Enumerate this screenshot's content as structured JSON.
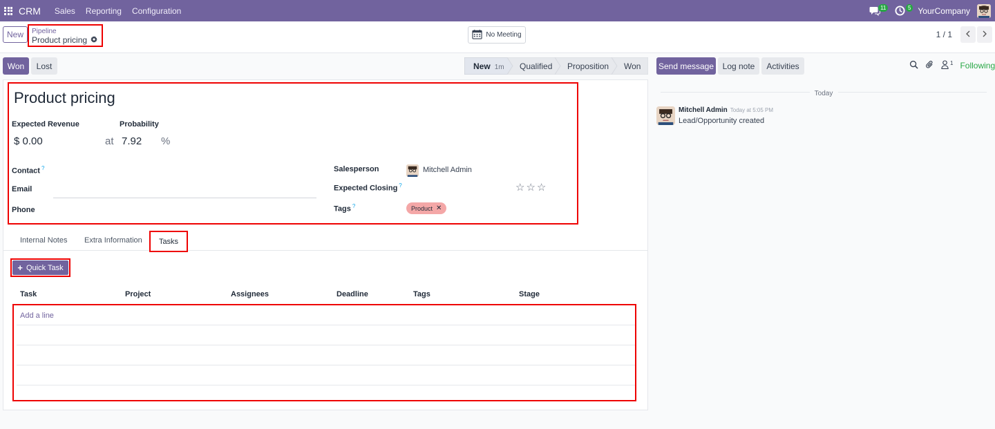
{
  "topbar": {
    "app_name": "CRM",
    "menu": [
      "Sales",
      "Reporting",
      "Configuration"
    ],
    "messages_count": "11",
    "activities_count": "5",
    "company": "YourCompany"
  },
  "control_panel": {
    "new_label": "New",
    "breadcrumb_parent": "Pipeline",
    "breadcrumb_current": "Product pricing",
    "meeting_label": "No Meeting",
    "pager": "1 / 1"
  },
  "statusbar": {
    "won_label": "Won",
    "lost_label": "Lost",
    "stages": [
      {
        "label": "New",
        "duration": "1m",
        "active": true
      },
      {
        "label": "Qualified"
      },
      {
        "label": "Proposition"
      },
      {
        "label": "Won"
      }
    ]
  },
  "chatter": {
    "send_label": "Send message",
    "log_label": "Log note",
    "activities_label": "Activities",
    "followers_count": "1",
    "following_label": "Following",
    "date_separator": "Today",
    "message": {
      "author": "Mitchell Admin",
      "time": "Today at 5:05 PM",
      "body": "Lead/Opportunity created"
    }
  },
  "form": {
    "title": "Product pricing",
    "expected_revenue_label": "Expected Revenue",
    "probability_label": "Probability",
    "revenue": "$ 0.00",
    "at": "at",
    "probability": "7.92",
    "percent": "%",
    "contact_label": "Contact",
    "email_label": "Email",
    "phone_label": "Phone",
    "help_mark": "?",
    "salesperson_label": "Salesperson",
    "salesperson": "Mitchell Admin",
    "expected_closing_label": "Expected Closing",
    "tags_label": "Tags",
    "tag": "Product",
    "priority_stars": 0
  },
  "tabs": {
    "items": [
      "Internal Notes",
      "Extra Information",
      "Tasks"
    ],
    "active": "Tasks"
  },
  "tasks": {
    "quick_task_label": "Quick Task",
    "columns": [
      "Task",
      "Project",
      "Assignees",
      "Deadline",
      "Tags",
      "Stage"
    ],
    "add_line_label": "Add a line"
  },
  "colors": {
    "brand": "#71639e",
    "highlight": "#ee0000",
    "following": "#28a745"
  }
}
